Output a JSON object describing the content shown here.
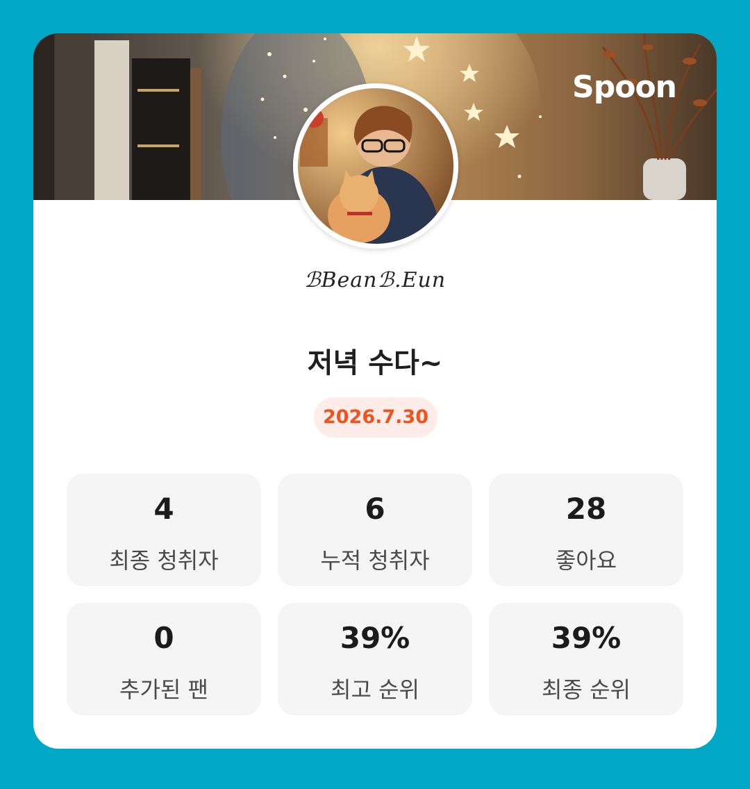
{
  "header": {
    "brand": "Spoon"
  },
  "profile": {
    "username": "ℬBeanℬ.Eun",
    "avatar_icon": "user-avatar-photo"
  },
  "live": {
    "title": "저녁 수다~",
    "date": "2026.7.30"
  },
  "stats": [
    {
      "value": "4",
      "label": "최종 청취자"
    },
    {
      "value": "6",
      "label": "누적 청취자"
    },
    {
      "value": "28",
      "label": "좋아요"
    },
    {
      "value": "0",
      "label": "추가된 팬"
    },
    {
      "value": "39%",
      "label": "최고 순위"
    },
    {
      "value": "39%",
      "label": "최종 순위"
    }
  ],
  "colors": {
    "background": "#00a8c6",
    "card": "#ffffff",
    "date_text": "#f0531c",
    "date_pill": "#fdece7",
    "stat_box": "#f5f5f5"
  }
}
